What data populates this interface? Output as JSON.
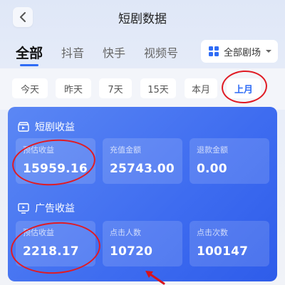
{
  "header": {
    "title": "短剧数据"
  },
  "platform_tabs": [
    {
      "label": "全部",
      "active": true
    },
    {
      "label": "抖音",
      "active": false
    },
    {
      "label": "快手",
      "active": false
    },
    {
      "label": "视频号",
      "active": false
    }
  ],
  "theater_filter": {
    "label": "全部剧场"
  },
  "time_filters": [
    {
      "label": "今天",
      "active": false
    },
    {
      "label": "昨天",
      "active": false
    },
    {
      "label": "7天",
      "active": false
    },
    {
      "label": "15天",
      "active": false
    },
    {
      "label": "本月",
      "active": false
    },
    {
      "label": "上月",
      "active": true
    }
  ],
  "drama_revenue": {
    "title": "短剧收益",
    "stats": [
      {
        "label": "预估收益",
        "value": "15959.16"
      },
      {
        "label": "充值金额",
        "value": "25743.00"
      },
      {
        "label": "退款金额",
        "value": "0.00"
      }
    ]
  },
  "ad_revenue": {
    "title": "广告收益",
    "stats": [
      {
        "label": "预估收益",
        "value": "2218.17"
      },
      {
        "label": "点击人数",
        "value": "10720"
      },
      {
        "label": "点击次数",
        "value": "100147"
      }
    ]
  },
  "colors": {
    "accent": "#2f6cf5",
    "card": "#3e6cf0",
    "annotation": "#e01b24"
  }
}
